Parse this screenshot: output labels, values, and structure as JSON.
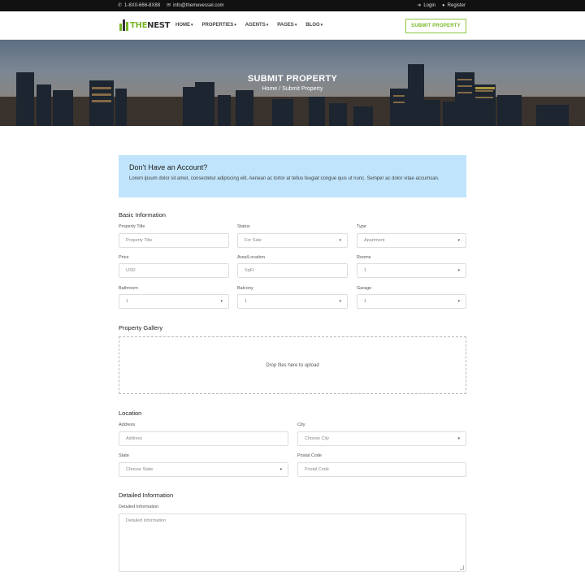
{
  "topbar": {
    "phone": "1-8X0-666-8X88",
    "email": "info@themevessel.com",
    "login": "Login",
    "register": "Register"
  },
  "brand": {
    "logo_part1": "THE",
    "logo_part2": "NEST",
    "accent_color": "#7ab82a"
  },
  "nav": {
    "items": [
      {
        "label": "HOME"
      },
      {
        "label": "PROPERTIES"
      },
      {
        "label": "AGENTS"
      },
      {
        "label": "PAGES"
      },
      {
        "label": "BLOG"
      }
    ],
    "submit_label": "SUBMIT PROPERTY"
  },
  "hero": {
    "title": "SUBMIT PROPERTY",
    "breadcrumb_home": "Home",
    "breadcrumb_sep": "/",
    "breadcrumb_current": "Submit Property"
  },
  "alert": {
    "title": "Don't Have an Account?",
    "body": "Lorem ipsum dolor sit amet, consectetur adipiscing elit. Aenean ac tortor at tellus feugiat congue quis ut nunc. Semper ac dolor vitae accumsan."
  },
  "basic": {
    "title": "Basic Information",
    "property_title": {
      "label": "Property Title",
      "placeholder": "Property Title"
    },
    "status": {
      "label": "Status",
      "value": "For Sale"
    },
    "type": {
      "label": "Type",
      "value": "Apartment"
    },
    "price": {
      "label": "Price",
      "placeholder": "USD"
    },
    "area": {
      "label": "Area/Location",
      "placeholder": "SqFt"
    },
    "rooms": {
      "label": "Rooms",
      "value": "1"
    },
    "bathroom": {
      "label": "Bathroom",
      "value": "1"
    },
    "balcony": {
      "label": "Balcony",
      "value": "1"
    },
    "garage": {
      "label": "Garage",
      "value": "1"
    }
  },
  "gallery": {
    "title": "Property Gallery",
    "dropzone_text": "Drop files here to upload"
  },
  "location": {
    "title": "Location",
    "address": {
      "label": "Address",
      "placeholder": "Address"
    },
    "city": {
      "label": "City",
      "value": "Choose City"
    },
    "state": {
      "label": "State",
      "value": "Choose State"
    },
    "postal": {
      "label": "Postal Code",
      "placeholder": "Postal Code"
    }
  },
  "detailed": {
    "title": "Detailed Information",
    "label": "Detailed Information",
    "placeholder": "Detailed Information"
  }
}
